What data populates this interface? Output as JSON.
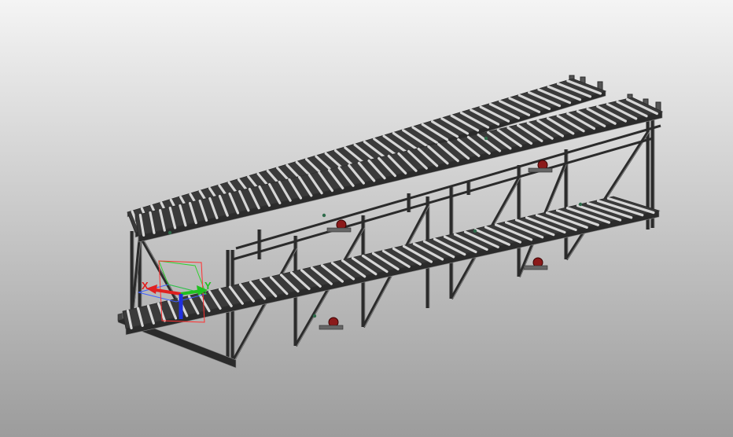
{
  "viewport": {
    "background_top": "#f4f4f4",
    "background_bottom": "#9c9c9c"
  },
  "model": {
    "frame_color": "#2b2b2b",
    "frame_highlight": "#8a8a8a",
    "roller_color": "#d6d6d6",
    "motor_color": "#8b1a1a",
    "sensor_color": "#2e6b4a"
  },
  "triad": {
    "x_label": "X",
    "y_label": "Y",
    "x_color": "#e02020",
    "y_color": "#20c020",
    "z_color": "#2030e0",
    "plane_xy_color": "#4060ff",
    "plane_yz_color": "#30d030",
    "plane_xz_color": "#ff3030"
  }
}
